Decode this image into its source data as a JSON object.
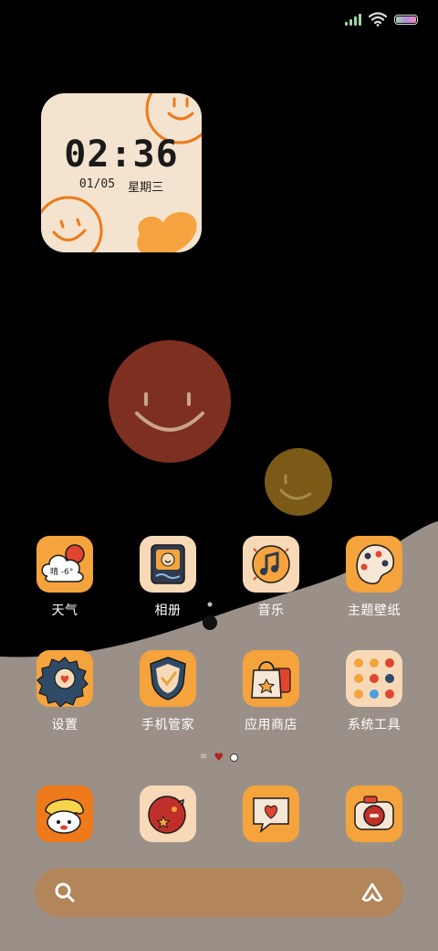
{
  "status_bar": {
    "signal_icon": "signal-bars-icon",
    "wifi_icon": "wifi-icon",
    "battery_icon": "battery-icon",
    "colors": {
      "signal": "#9fd6a0",
      "battery_fill": "#b48be6"
    }
  },
  "clock_widget": {
    "time": "02:36",
    "date": "01/05",
    "weekday": "星期三"
  },
  "weather_badge": "晴 -6°",
  "apps_row1": [
    {
      "label": "天气",
      "icon": "weather-icon"
    },
    {
      "label": "相册",
      "icon": "gallery-icon"
    },
    {
      "label": "音乐",
      "icon": "music-icon"
    },
    {
      "label": "主题壁纸",
      "icon": "themes-icon"
    }
  ],
  "apps_row2": [
    {
      "label": "设置",
      "icon": "settings-gear-icon"
    },
    {
      "label": "手机管家",
      "icon": "security-shield-icon"
    },
    {
      "label": "应用商店",
      "icon": "app-store-bag-icon"
    },
    {
      "label": "系统工具",
      "icon": "system-tools-folder-icon"
    }
  ],
  "dock": [
    {
      "icon": "phone-icon"
    },
    {
      "icon": "contacts-icon"
    },
    {
      "icon": "messages-icon"
    },
    {
      "icon": "camera-icon"
    }
  ],
  "search_bar": {
    "search_icon": "search-icon",
    "assistant_icon": "assistant-icon"
  },
  "colors": {
    "background": "#000000",
    "wave": "#9b9088",
    "icon_orange": "#f5a33c",
    "icon_peach": "#f7d9b8",
    "big_smiley": "#7e3020",
    "small_smiley": "#7a5a16",
    "search_bar": "#b3855b"
  }
}
